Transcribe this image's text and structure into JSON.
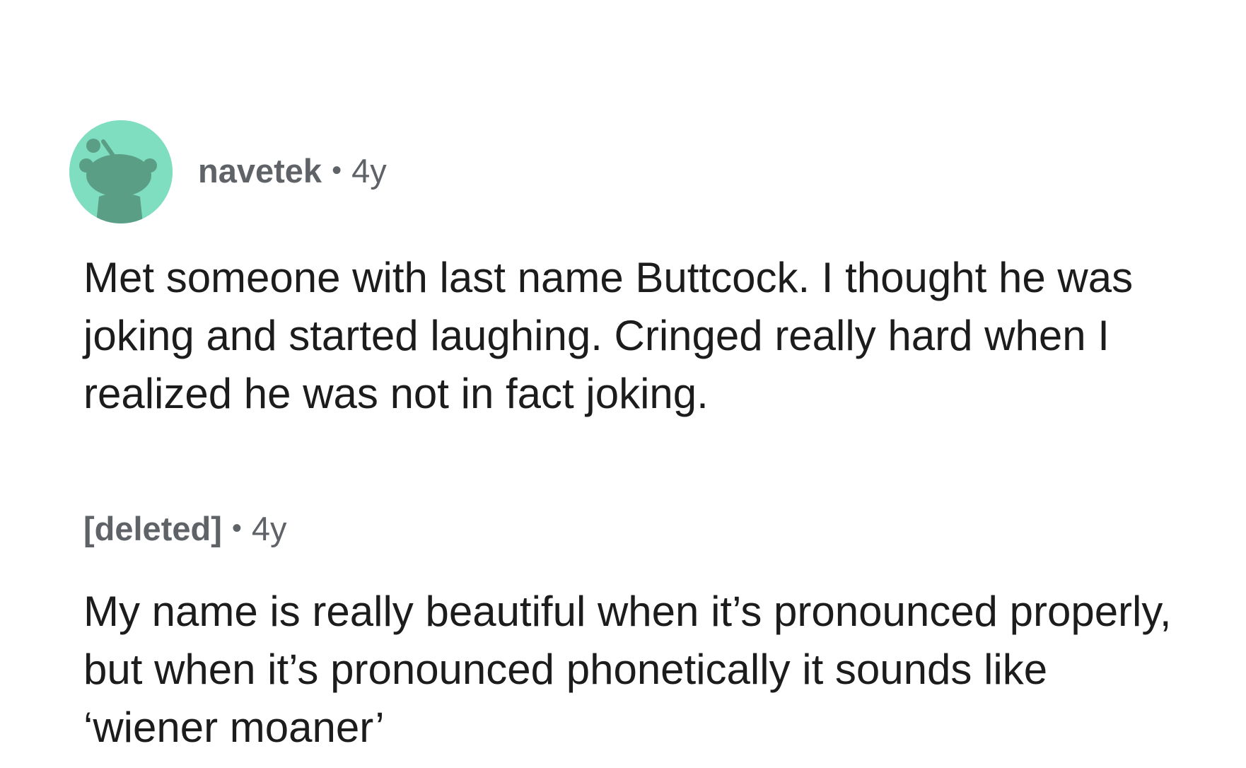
{
  "comments": [
    {
      "username": "navetek",
      "separator": "•",
      "age": "4y",
      "avatar_icon": "reddit-snoo-icon",
      "avatar_color": "#7fddc0",
      "text": "Met someone with last name Buttcock. I thought he was joking and started laughing. Cringed really hard when I realized he was not in fact joking."
    },
    {
      "username": "[deleted]",
      "separator": "•",
      "age": "4y",
      "text": "My name is really beautiful when it’s pronounced properly, but when it’s pronounced phonetically it sounds like ‘wiener moaner’"
    }
  ]
}
